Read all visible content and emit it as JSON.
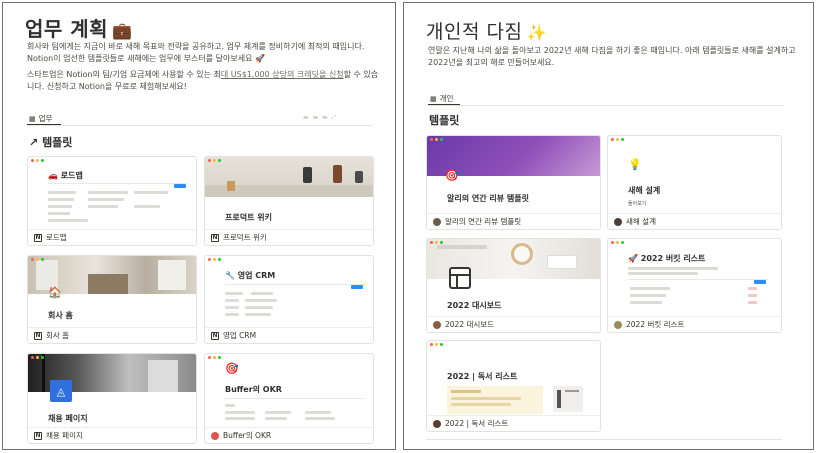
{
  "left": {
    "title": "업무 계획",
    "title_emoji": "💼",
    "desc_1": "회사와 팀에게는 지금이 바로 새해 목표와 전략을 공유하고, 업무 체계를 정비하기에 최적의 때입니다. Notion이 엄선한 템플릿들로 새해에는 업무에 부스터를 달아보세요 🚀",
    "desc_2_pre": "스타트업은 Notion의 팀/기업 요금제에 사용할 수 있는 최",
    "desc_2_link": "대 US$1,000 상당의 크레딧을 신청",
    "desc_2_post": "할 수 있습니다. 신청하고 Notion을 무료로 체험해보세요!",
    "tab_label": "업무",
    "section_title": "템플릿",
    "section_arrow": "↗",
    "cards": [
      {
        "title": "로드맵",
        "icon": "🚗",
        "footer": "로드맵"
      },
      {
        "title": "프로덕트 위키",
        "footer": "프로덕트 위키"
      },
      {
        "title": "회사 홈",
        "footer": "회사 홈"
      },
      {
        "title": "영업 CRM",
        "icon": "🔧",
        "footer": "영업 CRM"
      },
      {
        "title": "채용 페이지",
        "footer": "채용 페이지"
      },
      {
        "title": "Buffer의 OKR",
        "icon": "🎯",
        "footer": "Buffer의 OKR"
      }
    ]
  },
  "right": {
    "title": "개인적 다짐",
    "title_emoji": "✨",
    "desc": "연말은 지난해 나의 삶을 돌아보고 2022년 새해 다짐을 하기 좋은 때입니다. 아래 템플릿들로 새해를 설계하고 2022년을 최고의 해로 만들어보세요.",
    "tab_label": "개인",
    "section_title": "템플릿",
    "cards": [
      {
        "title": "알리의 연간 리뷰 템플릿",
        "icon": "🎯",
        "footer": "알리의 연간 리뷰 템플릿"
      },
      {
        "title": "새해 설계",
        "icon": "💡",
        "sub": "돌아보기",
        "footer": "새해 설계"
      },
      {
        "title": "2022 대시보드",
        "footer": "2022 대시보드"
      },
      {
        "title": "2022 버킷 리스트",
        "icon": "🚀",
        "footer": "2022 버킷 리스트"
      },
      {
        "title": "2022 | 독서 리스트",
        "footer": "2022 | 독서 리스트"
      }
    ]
  }
}
